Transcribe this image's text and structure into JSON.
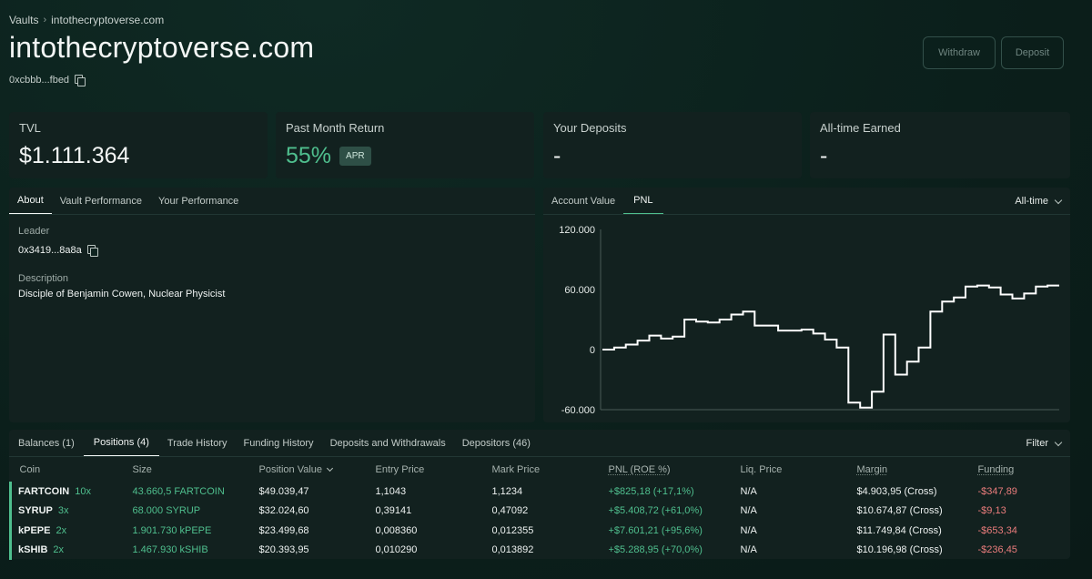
{
  "breadcrumb": {
    "root": "Vaults",
    "current": "intothecryptoverse.com"
  },
  "vault": {
    "title": "intothecryptoverse.com",
    "address": "0xcbbb...fbed"
  },
  "actions": {
    "withdraw": "Withdraw",
    "deposit": "Deposit"
  },
  "stats": {
    "tvl": {
      "label": "TVL",
      "value": "$1.111.364"
    },
    "month_return": {
      "label": "Past Month Return",
      "value": "55%",
      "badge": "APR"
    },
    "your_deposits": {
      "label": "Your Deposits",
      "value": "-"
    },
    "all_time_earned": {
      "label": "All-time Earned",
      "value": "-"
    }
  },
  "about_tabs": [
    "About",
    "Vault Performance",
    "Your Performance"
  ],
  "about": {
    "leader_label": "Leader",
    "leader": "0x3419...8a8a",
    "description_label": "Description",
    "description": "Disciple of Benjamin Cowen, Nuclear Physicist"
  },
  "chart_tabs": [
    "Account Value",
    "PNL"
  ],
  "chart_range": "All-time",
  "chart_data": {
    "type": "line",
    "step": true,
    "title": "",
    "xlabel": "",
    "ylabel": "",
    "ylim": [
      -60000,
      120000
    ],
    "yticks": [
      "120.000",
      "60.000",
      "0",
      "-60.000"
    ],
    "y": [
      0,
      2000,
      5000,
      9000,
      14000,
      11000,
      13000,
      30000,
      28000,
      27000,
      30000,
      35000,
      38000,
      24000,
      24000,
      19000,
      19000,
      20000,
      16000,
      10000,
      2000,
      -53000,
      -58000,
      -42000,
      15000,
      -25000,
      -12000,
      2000,
      38000,
      48000,
      52000,
      63000,
      64000,
      62000,
      55000,
      51000,
      56000,
      63000,
      64000
    ],
    "colors": {
      "line": "#ffffff"
    }
  },
  "bottom_tabs": [
    "Balances (1)",
    "Positions (4)",
    "Trade History",
    "Funding History",
    "Deposits and Withdrawals",
    "Depositors (46)"
  ],
  "filter_label": "Filter",
  "positions": {
    "columns": [
      "Coin",
      "Size",
      "Position Value",
      "Entry Price",
      "Mark Price",
      "PNL (ROE %)",
      "Liq. Price",
      "Margin",
      "Funding"
    ],
    "rows": [
      {
        "coin": "FARTCOIN",
        "lev": "10x",
        "size": "43.660,5 FARTCOIN",
        "value": "$49.039,47",
        "entry": "1,1043",
        "mark": "1,1234",
        "pnl": "+$825,18 (+17,1%)",
        "liq": "N/A",
        "margin": "$4.903,95 (Cross)",
        "funding": "-$347,89"
      },
      {
        "coin": "SYRUP",
        "lev": "3x",
        "size": "68.000 SYRUP",
        "value": "$32.024,60",
        "entry": "0,39141",
        "mark": "0,47092",
        "pnl": "+$5.408,72 (+61,0%)",
        "liq": "N/A",
        "margin": "$10.674,87 (Cross)",
        "funding": "-$9,13"
      },
      {
        "coin": "kPEPE",
        "lev": "2x",
        "size": "1.901.730 kPEPE",
        "value": "$23.499,68",
        "entry": "0,008360",
        "mark": "0,012355",
        "pnl": "+$7.601,21 (+95,6%)",
        "liq": "N/A",
        "margin": "$11.749,84 (Cross)",
        "funding": "-$653,34"
      },
      {
        "coin": "kSHIB",
        "lev": "2x",
        "size": "1.467.930 kSHIB",
        "value": "$20.393,95",
        "entry": "0,010290",
        "mark": "0,013892",
        "pnl": "+$5.288,95 (+70,0%)",
        "liq": "N/A",
        "margin": "$10.196,98 (Cross)",
        "funding": "-$236,45"
      }
    ]
  }
}
